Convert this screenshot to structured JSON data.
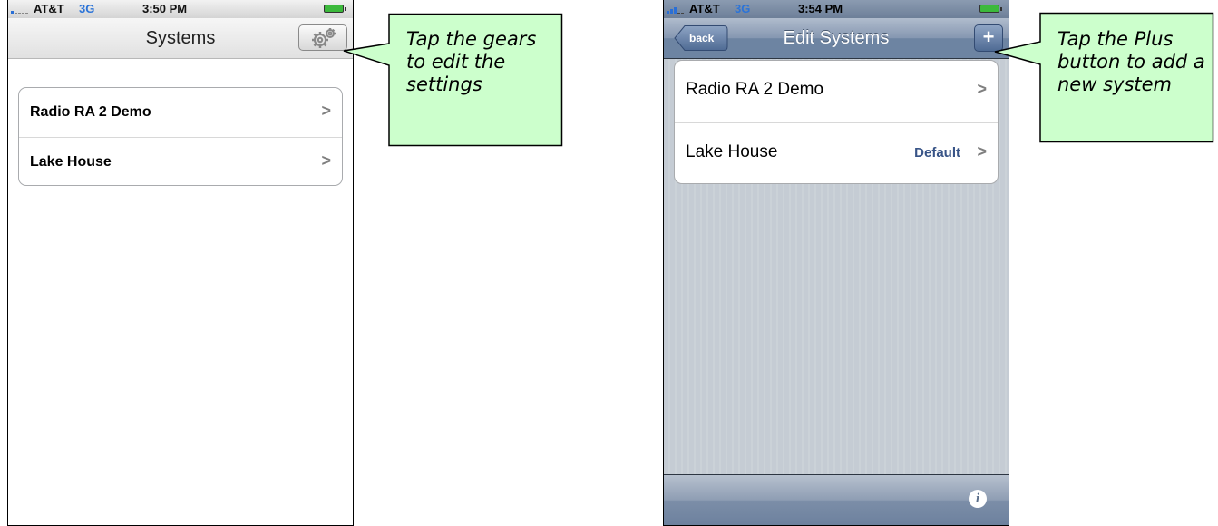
{
  "screen_left": {
    "status_bar": {
      "carrier": "AT&T",
      "network": "3G",
      "time": "3:50 PM",
      "signal_bars": 1
    },
    "nav_title": "Systems",
    "gear_icon": "gear-icon",
    "rows": [
      {
        "label": "Radio RA 2 Demo"
      },
      {
        "label": "Lake House"
      }
    ]
  },
  "screen_right": {
    "status_bar": {
      "carrier": "AT&T",
      "network": "3G",
      "time": "3:54 PM",
      "signal_bars": 3
    },
    "back_label": "back",
    "nav_title": "Edit Systems",
    "plus_label": "+",
    "rows": [
      {
        "label": "Radio RA 2 Demo",
        "detail": ""
      },
      {
        "label": "Lake House",
        "detail": "Default"
      }
    ],
    "info_label": "i"
  },
  "callouts": {
    "left": "Tap the gears to edit the settings",
    "right": "Tap the Plus button to add a new system"
  },
  "colors": {
    "callout_fill": "#ccffcc",
    "list_background": "#c5ccd4",
    "nav_blue": "#6d84a2",
    "detail_text": "#385487",
    "network_3g": "#2c74d8"
  }
}
